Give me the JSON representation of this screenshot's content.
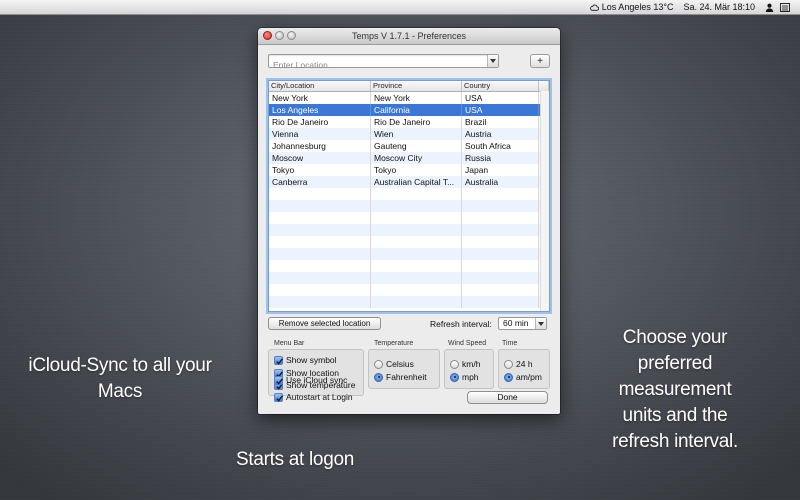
{
  "menubar": {
    "weather": "Los Angeles 13°C",
    "datetime": "Sa. 24. Mär  18:10"
  },
  "window": {
    "title": "Temps V 1.7.1 - Preferences",
    "location_placeholder": "Enter Location ...",
    "add_label": "+",
    "table": {
      "headers": [
        "City/Location",
        "Province",
        "Country"
      ],
      "rows": [
        [
          "New York",
          "New York",
          "USA"
        ],
        [
          "Los Angeles",
          "California",
          "USA"
        ],
        [
          "Rio De Janeiro",
          "Rio De Janeiro",
          "Brazil"
        ],
        [
          "Vienna",
          "Wien",
          "Austria"
        ],
        [
          "Johannesburg",
          "Gauteng",
          "South Africa"
        ],
        [
          "Moscow",
          "Moscow City",
          "Russia"
        ],
        [
          "Tokyo",
          "Tokyo",
          "Japan"
        ],
        [
          "Canberra",
          "Australian Capital T...",
          "Australia"
        ]
      ],
      "selected_row": 1
    },
    "remove_label": "Remove selected location",
    "refresh_label": "Refresh interval:",
    "refresh_value": "60 min",
    "menu_bar": {
      "title": "Menu Bar",
      "show_symbol": "Show symbol",
      "show_location": "Show location",
      "show_temperature": "Show temperature"
    },
    "temperature": {
      "title": "Temperature",
      "celsius": "Celsius",
      "fahrenheit": "Fahrenheit",
      "selected": "Fahrenheit"
    },
    "wind_speed": {
      "title": "Wind Speed",
      "kmh": "km/h",
      "mph": "mph",
      "selected": "mph"
    },
    "time": {
      "title": "Time",
      "h24": "24 h",
      "ampm": "am/pm",
      "selected": "am/pm"
    },
    "icloud_sync": "Use iCloud sync",
    "autostart": "Autostart at Login",
    "done_label": "Done"
  },
  "captions": {
    "left_line1": "iCloud-Sync to all your",
    "left_line2": "Macs",
    "bottom": "Starts at logon",
    "right_line1": "Choose your",
    "right_line2": "preferred",
    "right_line3": "measurement",
    "right_line4": "units and the",
    "right_line5": "refresh interval."
  },
  "colors": {
    "selection": "#3b77d6",
    "alt_row": "#edf3fe",
    "focus_ring": "#9ec1ef"
  }
}
